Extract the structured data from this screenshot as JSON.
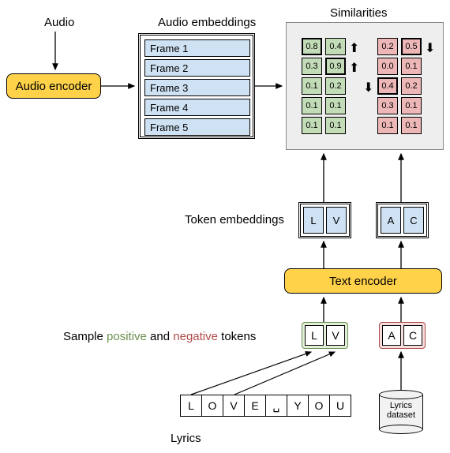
{
  "labels": {
    "audio": "Audio",
    "audio_encoder": "Audio encoder",
    "audio_embeddings": "Audio embeddings",
    "similarities": "Similarities",
    "token_embeddings": "Token embeddings",
    "text_encoder": "Text encoder",
    "sample_prefix": "Sample ",
    "sample_positive": "positive",
    "sample_mid": " and ",
    "sample_negative": "negative",
    "sample_suffix": " tokens",
    "lyrics": "Lyrics",
    "lyrics_dataset_l1": "Lyrics",
    "lyrics_dataset_l2": "dataset"
  },
  "frames": [
    "Frame 1",
    "Frame 2",
    "Frame 3",
    "Frame 4",
    "Frame 5"
  ],
  "similarities": {
    "positive": {
      "columns": [
        {
          "values": [
            "0.8",
            "0.3",
            "0.1",
            "0.1",
            "0.1"
          ],
          "highlight_row": 0
        },
        {
          "values": [
            "0.4",
            "0.9",
            "0.2",
            "0.1",
            "0.1"
          ],
          "highlight_row": 1
        }
      ]
    },
    "negative": {
      "columns": [
        {
          "values": [
            "0.2",
            "0.0",
            "0.4",
            "0.3",
            "0.1"
          ],
          "highlight_row": 2
        },
        {
          "values": [
            "0.5",
            "0.1",
            "0.2",
            "0.1",
            "0.1"
          ],
          "highlight_row": 0
        }
      ]
    }
  },
  "tokens": {
    "embedding_pair_left": [
      "L",
      "V"
    ],
    "embedding_pair_right": [
      "A",
      "C"
    ],
    "positive_sample": [
      "L",
      "V"
    ],
    "negative_sample": [
      "A",
      "C"
    ],
    "lyrics_chars": [
      "L",
      "O",
      "V",
      "E",
      "␣",
      "Y",
      "O",
      "U"
    ]
  },
  "colors": {
    "positive": "#6a8f4d",
    "negative": "#b24a4a"
  }
}
